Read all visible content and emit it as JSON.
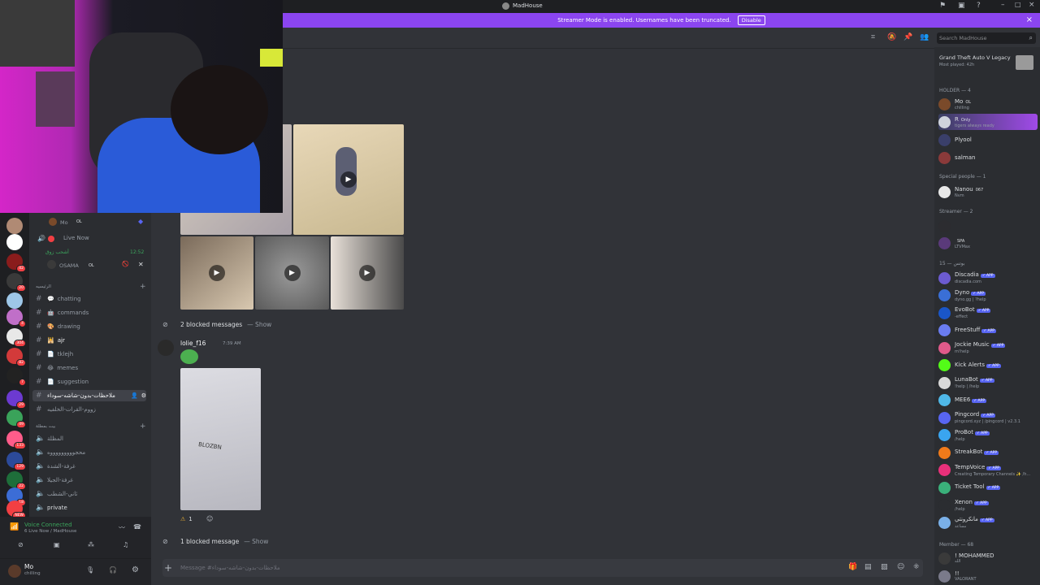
{
  "titlebar": {
    "server_title": "MadHouse"
  },
  "streamer_mode": {
    "message": "Streamer Mode is enabled. Usernames have been truncated.",
    "disable_label": "Disable"
  },
  "guilds": [
    {
      "color": "#b08a74",
      "badge": ""
    },
    {
      "color": "#ffffff",
      "badge": ""
    },
    {
      "color": "#8a1c1c",
      "badge": "42"
    },
    {
      "color": "#3a3a3a",
      "badge": "20"
    },
    {
      "color": "#9ec7e8",
      "badge": ""
    },
    {
      "color": "#c06fc8",
      "badge": "4"
    },
    {
      "color": "#e8e8e8",
      "badge": "304"
    },
    {
      "color": "#d33a3a",
      "badge": "82"
    },
    {
      "color": "#222222",
      "badge": "7"
    },
    {
      "color": "#6c3ad1",
      "badge": "29"
    },
    {
      "color": "#3aa35a",
      "badge": "49"
    },
    {
      "color": "#ff5c8a",
      "badge": "133"
    },
    {
      "color": "#2c4a9a",
      "badge": "129"
    },
    {
      "color": "#1e6e3a",
      "badge": "22"
    },
    {
      "color": "#3c6dd6",
      "badge": "18"
    },
    {
      "color": "#f23f43",
      "badge": "NEW"
    }
  ],
  "sidebar": {
    "voice_users": [
      {
        "name": "Mo",
        "tag": "OL",
        "time": ""
      },
      {
        "name": "Live Now",
        "tag": "",
        "time": ""
      },
      {
        "name": "أشحب زوق",
        "tag": "",
        "time": "12:52"
      },
      {
        "name": "OSAMA",
        "tag": "OL",
        "time": ""
      }
    ],
    "category1": "الرئيسيه",
    "channels": [
      {
        "name": "chatting",
        "emoji": "💬"
      },
      {
        "name": "commands",
        "emoji": "🤖"
      },
      {
        "name": "drawing",
        "emoji": "🎨"
      },
      {
        "name": "ajr",
        "emoji": "🕌"
      },
      {
        "name": "tklejh",
        "emoji": "📄"
      },
      {
        "name": "memes",
        "emoji": "😂"
      },
      {
        "name": "suggestion",
        "emoji": "📄"
      },
      {
        "name": "ملاحظات-بدون-شاشه-سوداء",
        "emoji": ""
      },
      {
        "name": "زووم-القرات-الخلفيه",
        "emoji": ""
      }
    ],
    "category2": "بيت بمطلة",
    "voice_channels": [
      "المظلة",
      "محجوووووووووه",
      "غرفة-الشدة",
      "غرفة-الجيلا",
      "ثاني-الشطب",
      "private"
    ]
  },
  "voice_panel": {
    "status": "Voice Connected",
    "detail": "6 Live Now / MadHouse"
  },
  "user_panel": {
    "name": "Mo",
    "status": "chilling"
  },
  "chat": {
    "blocked_1": "2 blocked messages",
    "show_1": "— Show",
    "author": "lolie_f16",
    "timestamp": "7:39 AM",
    "photo_text": "BLOZBN",
    "reaction_count": "1",
    "blocked_2": "1 blocked message",
    "show_2": "— Show",
    "composer_placeholder": "Message #ملاحظات-بدون-شاشه-سوداء"
  },
  "header": {
    "search_placeholder": "Search MadHouse"
  },
  "members": {
    "game_title": "Grand Theft Auto V Legacy",
    "game_sub": "Most played: 42h",
    "categories": [
      "HOLDER — 4",
      "Special people — 1",
      "Streamer — 2",
      "بوتس — 15",
      "Member — 68"
    ],
    "holder": [
      {
        "name": "Mo",
        "sub": "chilling",
        "tag": "OL",
        "color": "#7a4a2a"
      },
      {
        "name": "R",
        "sub": "tigers always ready",
        "tag": "Only",
        "color": "#cfd3dc"
      },
      {
        "name": "Plyool",
        "sub": "",
        "tag": "",
        "color": "#3a3f6a"
      },
      {
        "name": "salman",
        "sub": "",
        "tag": "",
        "color": "#8a3a3a"
      }
    ],
    "special": [
      {
        "name": "Nanou",
        "sub": "Nvm",
        "tag": "067",
        "color": "#e8e8e8"
      }
    ],
    "streamer": [
      {
        "name": "",
        "sub": "",
        "tag": "",
        "color": "#2c2c30"
      },
      {
        "name": "",
        "sub": "LTVMax",
        "tag": "SPA",
        "color": "#5a3a7a"
      }
    ],
    "bots": [
      {
        "name": "Discadia",
        "sub": "discadia.com",
        "color": "#6c5bd1"
      },
      {
        "name": "Dyno",
        "sub": "dyno.gg | ?help",
        "color": "#3a6fd6"
      },
      {
        "name": "EvoBot",
        "sub": "-effect",
        "color": "#1a56c8"
      },
      {
        "name": "FreeStuff",
        "sub": "",
        "color": "#6a7cf0"
      },
      {
        "name": "Jockie Music",
        "sub": "m!help",
        "color": "#e05a8a"
      },
      {
        "name": "Kick Alerts",
        "sub": "",
        "color": "#53fc18"
      },
      {
        "name": "LunaBot",
        "sub": "!help | /help",
        "color": "#d9d9d9"
      },
      {
        "name": "MEE6",
        "sub": "",
        "color": "#4fb8e8"
      },
      {
        "name": "Pingcord",
        "sub": "pingcord.xyz | /pingcord | v2.3.1",
        "color": "#5865f2"
      },
      {
        "name": "ProBot",
        "sub": "/help",
        "color": "#3aa5f0"
      },
      {
        "name": "StreakBot",
        "sub": "",
        "color": "#f07a1a"
      },
      {
        "name": "TempVoice",
        "sub": "Creating Temporary Channels ✨ /h...",
        "color": "#e8307a"
      },
      {
        "name": "Ticket Tool",
        "sub": "",
        "color": "#3ab07a"
      },
      {
        "name": "Xenon",
        "sub": "/help",
        "color": "#2b2d31"
      },
      {
        "name": "مانكرونتي",
        "sub": "مساعد",
        "color": "#7ab0e8"
      }
    ],
    "member": [
      {
        "name": "! MOHAMMED",
        "sub": "الله",
        "color": "#3a3a3a"
      },
      {
        "name": "!!",
        "sub": "VALORANT",
        "color": "#7a7a8a"
      }
    ]
  }
}
